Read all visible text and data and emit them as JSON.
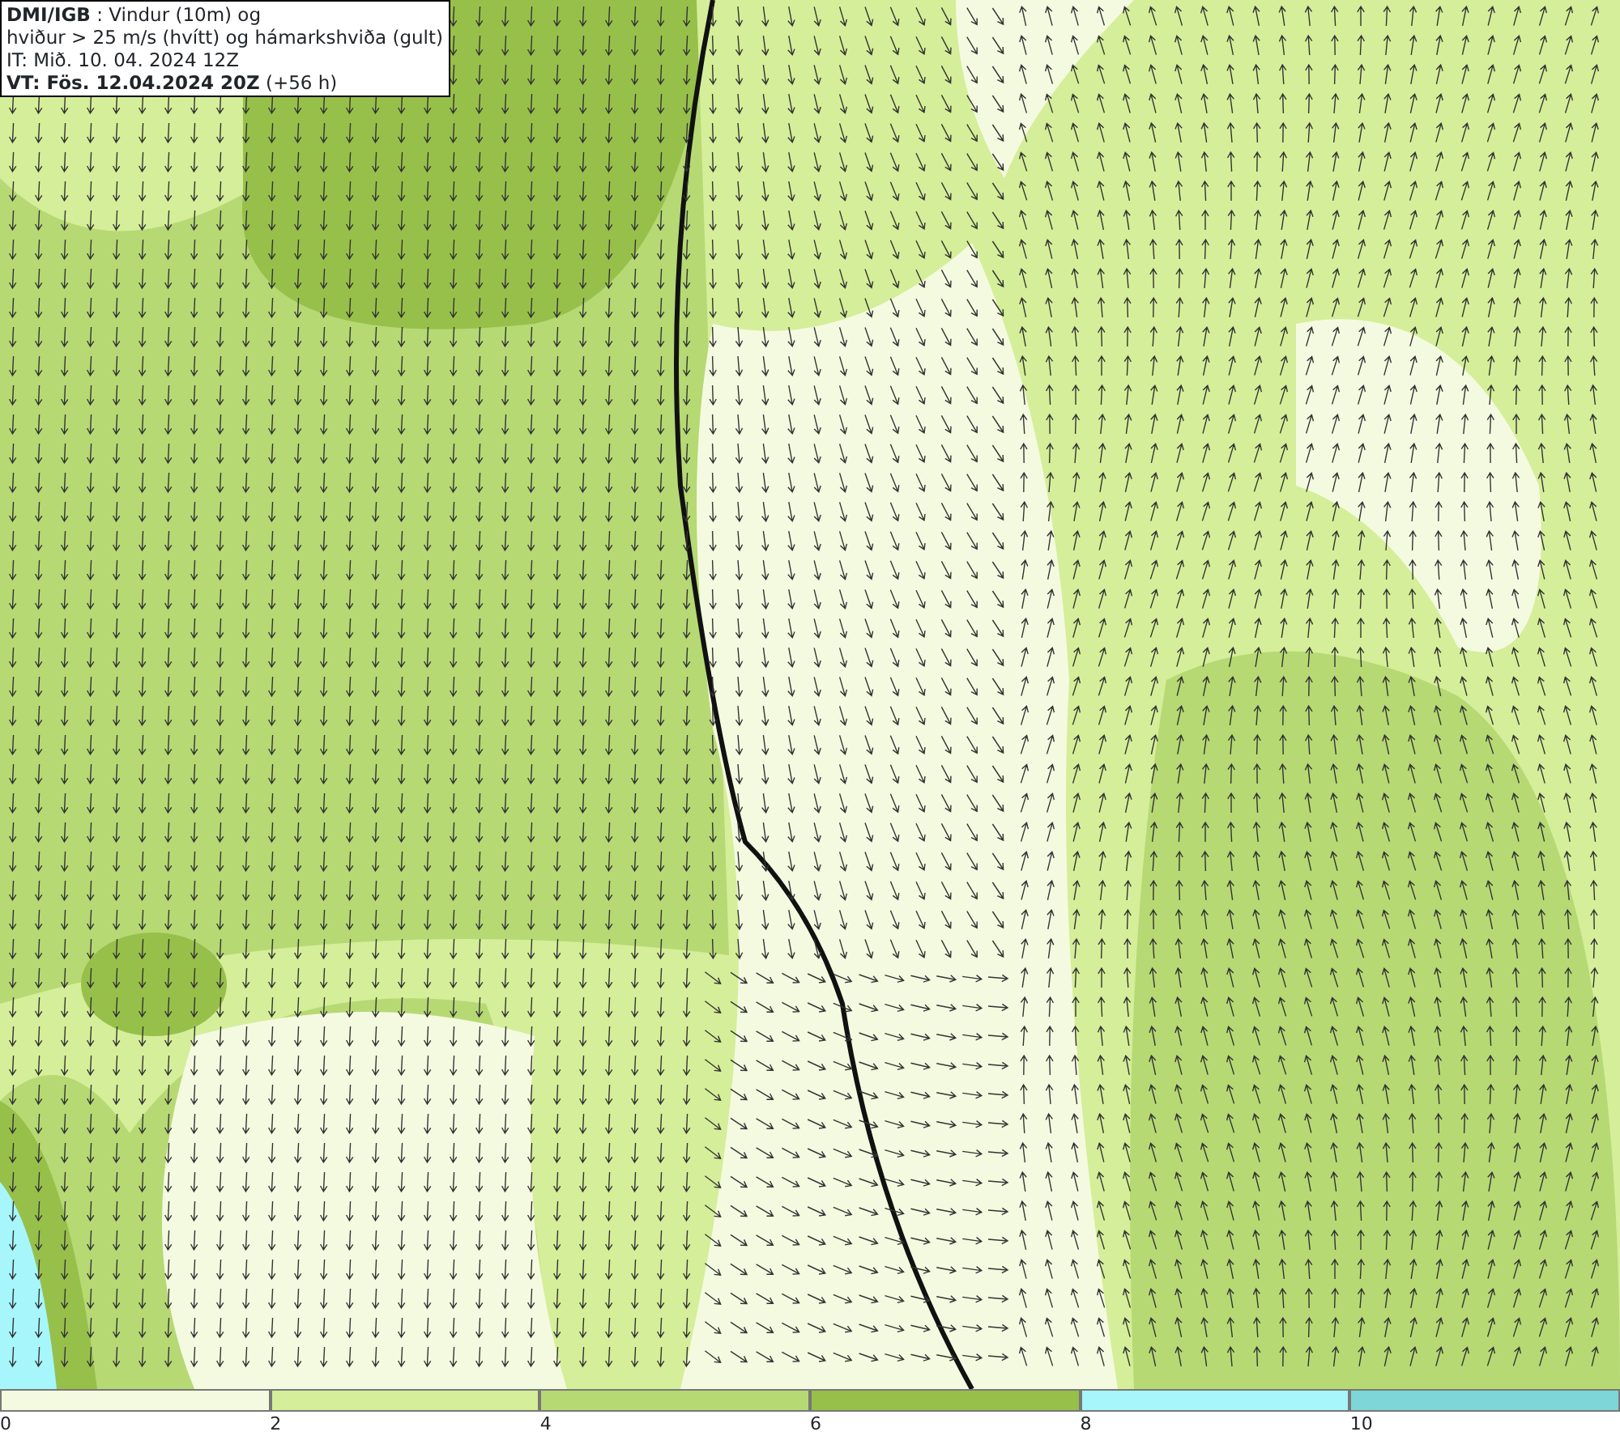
{
  "info_box": {
    "lines": [
      "**DMI/IGB** : Vindur (10m) og",
      "hviður > 25 m/s (hvítt) og hámarkshviða (gult)",
      "IT: Mið. 10. 04. 2024 12Z",
      "**VT: Fös. 12.04.2024 20Z** (+56 h)"
    ]
  },
  "color_scale": {
    "segments": [
      {
        "color": "#f4fae0",
        "label": "0"
      },
      {
        "color": "#d5ee99",
        "label": "2"
      },
      {
        "color": "#b6d974",
        "label": "4"
      },
      {
        "color": "#97c04b",
        "label": "6"
      },
      {
        "color": "#a6f6fb",
        "label": "8"
      },
      {
        "color": "#7ed6d8",
        "label": "10"
      }
    ]
  }
}
